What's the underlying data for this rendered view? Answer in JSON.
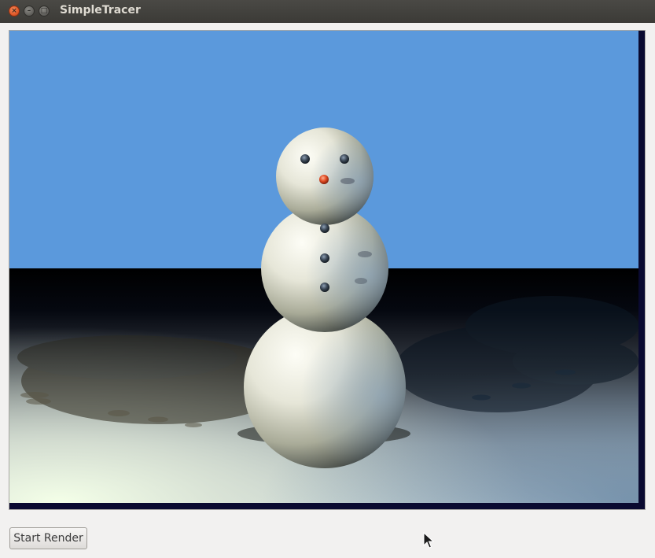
{
  "window": {
    "title": "SimpleTracer",
    "close_glyph": "×",
    "minimize_glyph": "–",
    "maximize_glyph": "□"
  },
  "render_view": {
    "scene": "snowman-render",
    "sky_color": "#5b99dc",
    "border_color": "#0a0a30"
  },
  "controls": {
    "start_render_label": "Start Render"
  }
}
